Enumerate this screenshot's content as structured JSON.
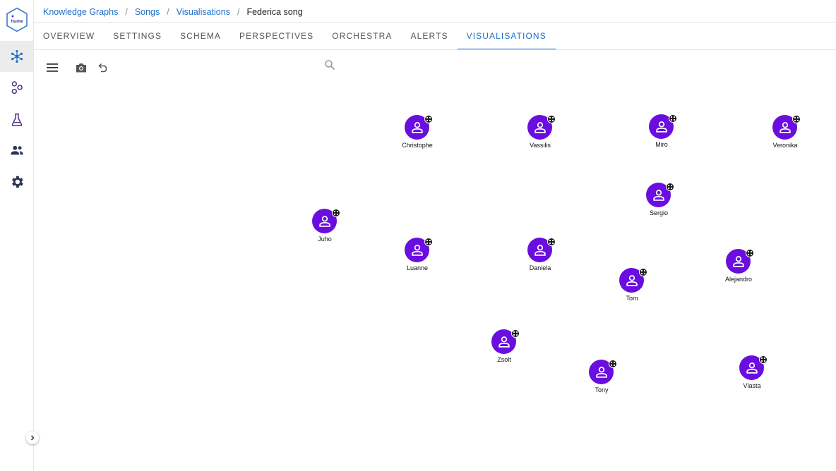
{
  "breadcrumb": {
    "items": [
      "Knowledge Graphs",
      "Songs",
      "Visualisations"
    ],
    "separator": "/",
    "current": "Federica song"
  },
  "tabs": [
    {
      "label": "OVERVIEW",
      "active": false
    },
    {
      "label": "SETTINGS",
      "active": false
    },
    {
      "label": "SCHEMA",
      "active": false
    },
    {
      "label": "PERSPECTIVES",
      "active": false
    },
    {
      "label": "ORCHESTRA",
      "active": false
    },
    {
      "label": "ALERTS",
      "active": false
    },
    {
      "label": "VISUALISATIONS",
      "active": true
    }
  ],
  "sidebar": {
    "logo_text": "hume",
    "items": [
      {
        "icon": "graph-network-icon",
        "active": true
      },
      {
        "icon": "bubbles-icon",
        "active": false
      },
      {
        "icon": "flask-icon",
        "active": false
      },
      {
        "icon": "people-icon",
        "active": false
      },
      {
        "icon": "gear-icon",
        "active": false
      }
    ]
  },
  "toolbar": {
    "icons": [
      "menu-icon",
      "camera-icon",
      "undo-icon",
      "search-icon"
    ]
  },
  "graph": {
    "node_color": "#6a0ddf",
    "nodes": [
      {
        "label": "Christophe"
      },
      {
        "label": "Vassilis"
      },
      {
        "label": "Miro"
      },
      {
        "label": "Veronika"
      },
      {
        "label": "Sergio"
      },
      {
        "label": "Juho"
      },
      {
        "label": "Luanne"
      },
      {
        "label": "Daniela"
      },
      {
        "label": "Alejandro"
      },
      {
        "label": "Tom"
      },
      {
        "label": "Zsolt"
      },
      {
        "label": "Tony"
      },
      {
        "label": "Vlasta"
      }
    ]
  },
  "colors": {
    "accent": "#1e6ec8",
    "node": "#6a0ddf",
    "sidebar_active": "#ececec"
  }
}
